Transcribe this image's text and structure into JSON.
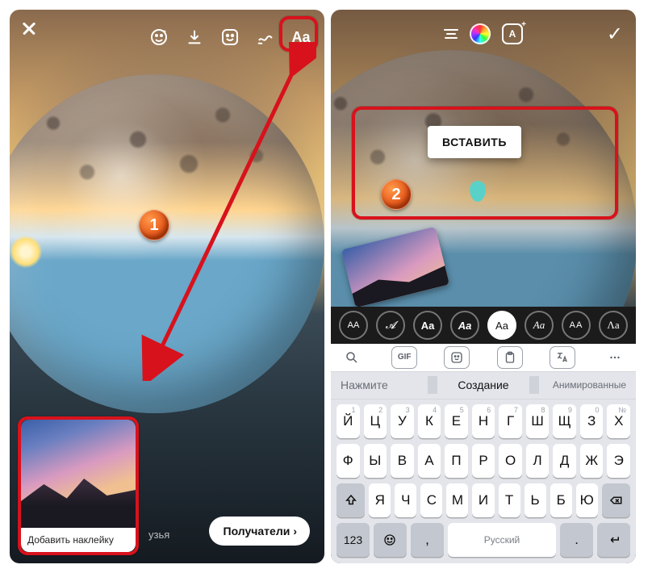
{
  "markers": {
    "one": "1",
    "two": "2"
  },
  "left": {
    "toolbar": {
      "close": "close",
      "face": "face-filter",
      "download": "download",
      "sticker": "sticker",
      "draw": "draw",
      "text_label": "Aa"
    },
    "sticker_popup_label": "Добавить наклейку",
    "behind_label": "узья",
    "recipients_label": "Получатели",
    "recipients_chev": "›"
  },
  "right": {
    "toolbar": {
      "align": "align-center",
      "color": "color-picker",
      "effects_label": "A",
      "done": "✓"
    },
    "paste_label": "ВСТАВИТЬ",
    "font_chips": [
      "AA",
      "𝓐",
      "Aa",
      "Aa",
      "Aa",
      "Aa",
      "AA",
      "Λа"
    ],
    "font_active_index": 4,
    "kb_toolstrip": {
      "gif": "GIF"
    },
    "suggestions": {
      "left": "Нажмите",
      "mid": "Создание",
      "right": "Анимированные"
    },
    "rows": {
      "r1": [
        {
          "c": "Й",
          "s": "1"
        },
        {
          "c": "Ц",
          "s": "2"
        },
        {
          "c": "У",
          "s": "3"
        },
        {
          "c": "К",
          "s": "4"
        },
        {
          "c": "Е",
          "s": "5"
        },
        {
          "c": "Н",
          "s": "6"
        },
        {
          "c": "Г",
          "s": "7"
        },
        {
          "c": "Ш",
          "s": "8"
        },
        {
          "c": "Щ",
          "s": "9"
        },
        {
          "c": "З",
          "s": "0"
        },
        {
          "c": "Х",
          "s": "№"
        }
      ],
      "r2": [
        "Ф",
        "Ы",
        "В",
        "А",
        "П",
        "Р",
        "О",
        "Л",
        "Д",
        "Ж",
        "Э"
      ],
      "r3": [
        "Я",
        "Ч",
        "С",
        "М",
        "И",
        "Т",
        "Ь",
        "Б",
        "Ю"
      ],
      "r4": {
        "sym": "123",
        "space": "Русский"
      }
    }
  }
}
